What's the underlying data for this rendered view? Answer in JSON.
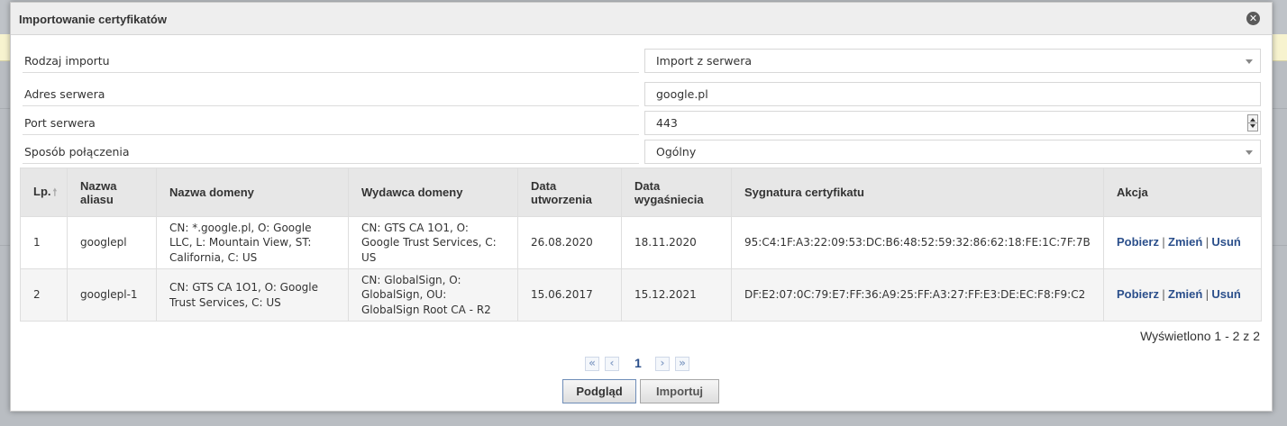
{
  "dialog": {
    "title": "Importowanie certyfikatów",
    "close_glyph": "✕"
  },
  "form": {
    "import_type": {
      "label": "Rodzaj importu",
      "value": "Import z serwera"
    },
    "server_address": {
      "label": "Adres serwera",
      "value": "google.pl"
    },
    "server_port": {
      "label": "Port serwera",
      "value": "443"
    },
    "connection_mode": {
      "label": "Sposób połączenia",
      "value": "Ogólny"
    }
  },
  "table": {
    "headers": {
      "lp": "Lp.",
      "alias": "Nazwa aliasu",
      "domain": "Nazwa domeny",
      "issuer": "Wydawca domeny",
      "created": "Data utworzenia",
      "expires": "Data wygaśniecia",
      "signature": "Sygnatura certyfikatu",
      "action": "Akcja"
    },
    "rows": [
      {
        "lp": "1",
        "alias": "googlepl",
        "domain": "CN: *.google.pl, O: Google LLC, L: Mountain View, ST: California, C: US",
        "issuer": "CN: GTS CA 1O1, O: Google Trust Services, C: US",
        "created": "26.08.2020",
        "expires": "18.11.2020",
        "signature": "95:C4:1F:A3:22:09:53:DC:B6:48:52:59:32:86:62:18:FE:1C:7F:7B",
        "actions": {
          "download": "Pobierz",
          "change": "Zmień",
          "delete": "Usuń",
          "sep": "|"
        }
      },
      {
        "lp": "2",
        "alias": "googlepl-1",
        "domain": "CN: GTS CA 1O1, O: Google Trust Services, C: US",
        "issuer": "CN: GlobalSign, O: GlobalSign, OU: GlobalSign Root CA - R2",
        "created": "15.06.2017",
        "expires": "15.12.2021",
        "signature": "DF:E2:07:0C:79:E7:FF:36:A9:25:FF:A3:27:FF:E3:DE:EC:F8:F9:C2",
        "actions": {
          "download": "Pobierz",
          "change": "Zmień",
          "delete": "Usuń",
          "sep": "|"
        }
      }
    ]
  },
  "summary": "Wyświetlono 1 - 2 z 2",
  "pager": {
    "first": "«",
    "prev": "‹",
    "current": "1",
    "next": "›",
    "last": "»"
  },
  "buttons": {
    "preview": "Podgląd",
    "import": "Importuj"
  },
  "colors": {
    "link": "#2b4f8b",
    "header_bg": "#e7e7e7"
  }
}
